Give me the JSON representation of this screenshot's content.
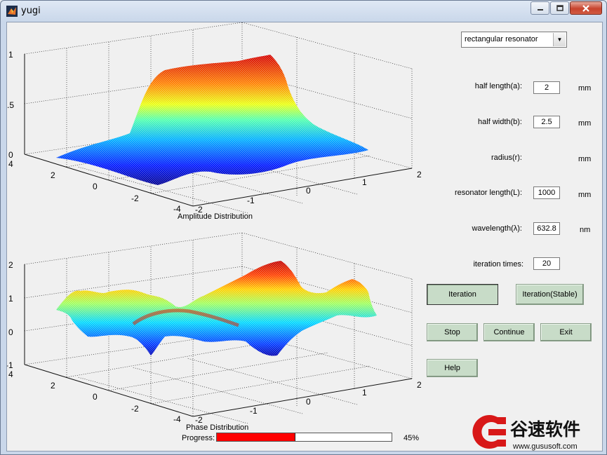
{
  "window": {
    "title": "yugi"
  },
  "controls": {
    "resonator_type": "rectangular resonator",
    "half_length_label": "half length(a):",
    "half_length_value": "2",
    "half_length_unit": "mm",
    "half_width_label": "half  width(b):",
    "half_width_value": "2.5",
    "half_width_unit": "mm",
    "radius_label": "radius(r):",
    "radius_unit": "mm",
    "resonator_length_label": "resonator length(L):",
    "resonator_length_value": "1000",
    "resonator_length_unit": "mm",
    "wavelength_label": "wavelength(λ):",
    "wavelength_value": "632.8",
    "wavelength_unit": "nm",
    "iteration_times_label": "iteration times:",
    "iteration_times_value": "20"
  },
  "buttons": {
    "iteration": "Iteration",
    "iteration_stable": "Iteration(Stable)",
    "stop": "Stop",
    "continue": "Continue",
    "exit": "Exit",
    "help": "Help"
  },
  "progress": {
    "label": "Progress:",
    "percent_text": "45%",
    "fraction": 0.45
  },
  "watermark": {
    "brand": "谷速软件",
    "url": "www.gususoft.com"
  },
  "plots": {
    "amplitude": {
      "title": "Amplitude Distribution",
      "z_ticks": [
        "1",
        ".5",
        "0"
      ],
      "left_ticks": [
        "4",
        "2",
        "0",
        "-2",
        "-4"
      ],
      "right_ticks": [
        "-2",
        "-1",
        "0",
        "1",
        "2"
      ]
    },
    "phase": {
      "title": "Phase Distribution",
      "z_ticks": [
        "2",
        "1",
        "0",
        "-1"
      ],
      "left_ticks": [
        "4",
        "2",
        "0",
        "-2",
        "-4"
      ],
      "right_ticks": [
        "-2",
        "-1",
        "0",
        "1",
        "2"
      ]
    }
  },
  "chart_data": [
    {
      "type": "surface",
      "title": "Amplitude Distribution",
      "zlim": [
        0,
        1
      ],
      "x_range": [
        -2,
        2
      ],
      "y_range": [
        -4,
        4
      ],
      "description_values": {
        "peak": 1.0,
        "base": 0.0
      },
      "colormap": "jet"
    },
    {
      "type": "surface",
      "title": "Phase Distribution",
      "zlim": [
        -1,
        2
      ],
      "x_range": [
        -2,
        2
      ],
      "y_range": [
        -4,
        4
      ],
      "colormap": "jet"
    }
  ],
  "colors": {
    "button_green": "#c8dcc8",
    "progress_fill": "#ff0000"
  }
}
